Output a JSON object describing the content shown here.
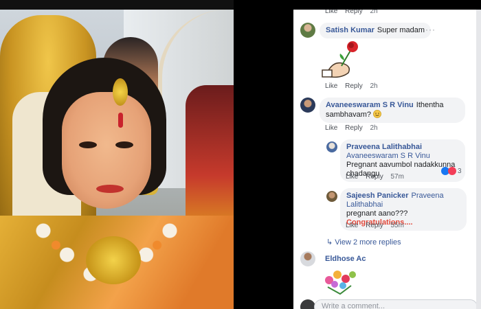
{
  "comments": [
    {
      "name": "Satish Kumar",
      "text": "Super madam",
      "actions": {
        "like": "Like",
        "reply": "Reply",
        "time": "2h"
      }
    },
    {
      "name": "Avaneeswaram S R Vinu",
      "text": "Ithentha sambhavam?",
      "actions": {
        "like": "Like",
        "reply": "Reply",
        "time": "2h"
      }
    },
    {
      "name": "Praveena Lalithabhai",
      "mention": "Avaneeswaram S R Vinu",
      "text": "Pregnant aavumbol nadakkunna chadangu",
      "reaction_count": "3",
      "actions": {
        "like": "Like",
        "reply": "Reply",
        "time": "57m"
      }
    },
    {
      "name": "Sajeesh Panicker",
      "mention": "Praveena Lalithabhai",
      "text": "pregnant aano???",
      "highlight": "Congratulations....",
      "actions": {
        "like": "Like",
        "reply": "Reply",
        "time": "55m"
      }
    },
    {
      "name": "Eldhose Ac"
    }
  ],
  "top_actions": {
    "like": "Like",
    "reply": "Reply",
    "time": "2h"
  },
  "view_more": "View 2 more replies",
  "composer_placeholder": "Write a comment...",
  "colors": {
    "link": "#385898",
    "highlight": "#e2483a",
    "bubble": "#f2f3f5"
  }
}
